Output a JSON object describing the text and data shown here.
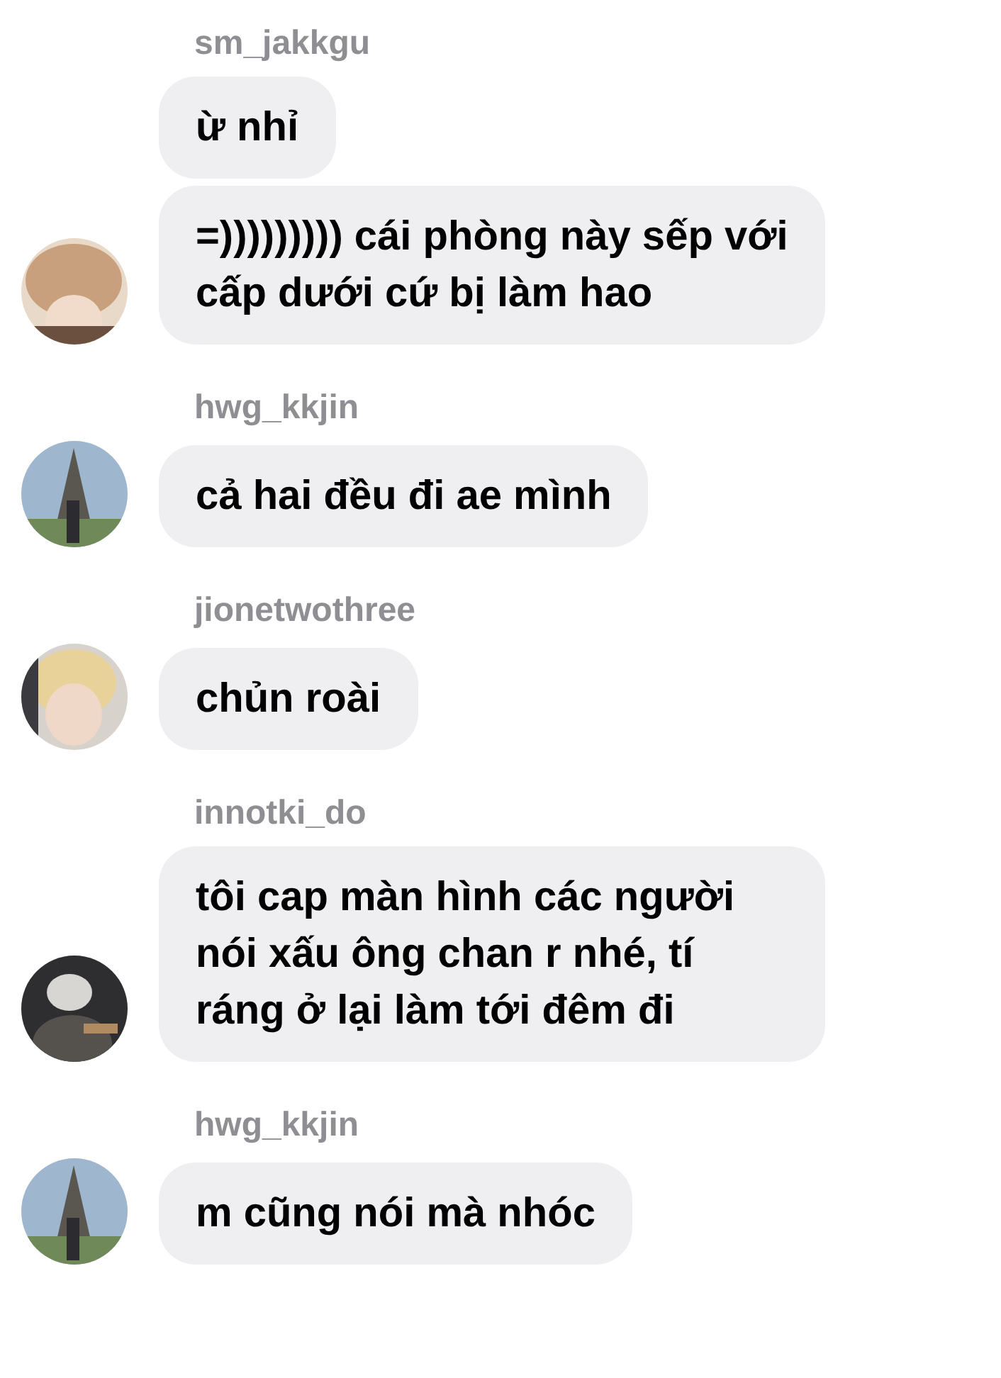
{
  "groups": [
    {
      "username": "sm_jakkgu",
      "avatar": {
        "kind": "picture"
      },
      "messages": [
        "ừ nhỉ",
        "=))))))))) cái phòng này sếp với cấp dưới cứ bị làm hao"
      ]
    },
    {
      "username": "hwg_kkjin",
      "avatar": {
        "kind": "picture"
      },
      "messages": [
        "cả hai đều đi ae mình"
      ]
    },
    {
      "username": "jionetwothree",
      "avatar": {
        "kind": "picture"
      },
      "messages": [
        "chủn roài"
      ]
    },
    {
      "username": "innotki_do",
      "avatar": {
        "kind": "picture"
      },
      "messages": [
        "tôi cap màn hình các người nói xấu ông chan r nhé, tí ráng ở lại làm tới đêm đi"
      ]
    },
    {
      "username": "hwg_kkjin",
      "avatar": {
        "kind": "picture"
      },
      "messages": [
        "m cũng nói mà nhóc"
      ]
    }
  ]
}
